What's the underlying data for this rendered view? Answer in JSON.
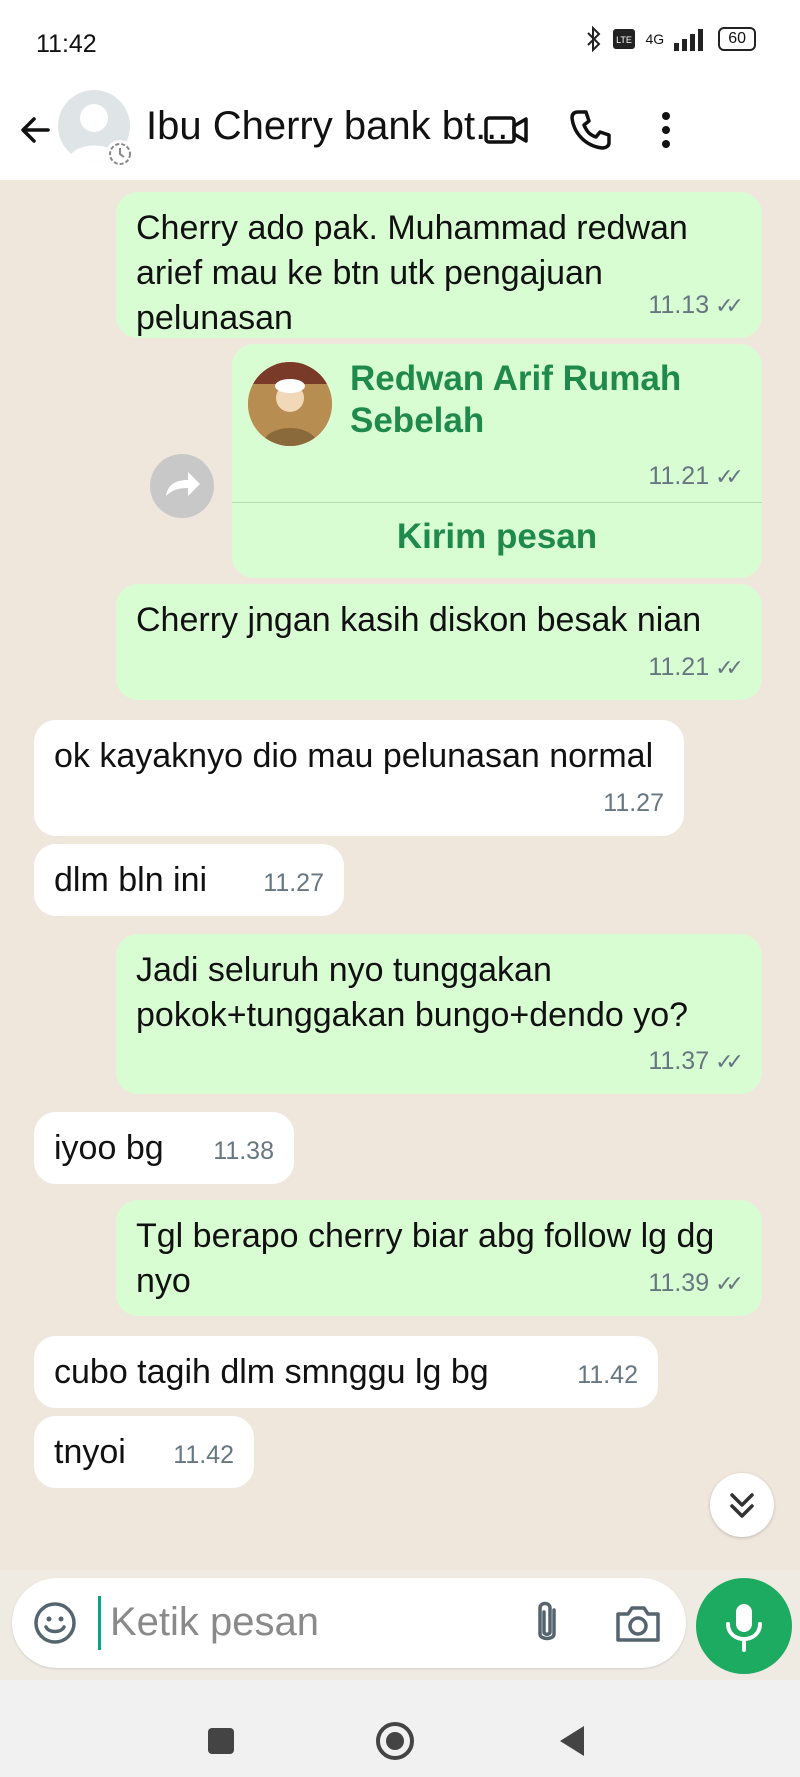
{
  "status_bar": {
    "time": "11:42",
    "network": "4G",
    "battery": "60"
  },
  "header": {
    "title": "Ibu Cherry bank bt..."
  },
  "messages": [
    {
      "text": "Cherry ado pak. Muhammad redwan arief mau ke btn utk pengajuan pelunasan",
      "time": "11.13"
    },
    {
      "contact_name": "Redwan Arif Rumah Sebelah",
      "time": "11.21",
      "action": "Kirim pesan"
    },
    {
      "text": "Cherry jngan kasih diskon besak nian",
      "time": "11.21"
    },
    {
      "text": "ok kayaknyo dio mau pelunasan normal",
      "time": "11.27"
    },
    {
      "text": "dlm bln ini",
      "time": "11.27"
    },
    {
      "text": "Jadi seluruh nyo tunggakan pokok+tunggakan bungo+dendo yo?",
      "time": "11.37"
    },
    {
      "text": "iyoo bg",
      "time": "11.38"
    },
    {
      "text": "Tgl berapo cherry biar abg follow lg dg nyo",
      "time": "11.39"
    },
    {
      "text": "cubo tagih dlm smnggu lg bg",
      "time": "11.42"
    },
    {
      "text": "tnyoi",
      "time": "11.42"
    }
  ],
  "composer": {
    "placeholder": "Ketik pesan"
  },
  "colors": {
    "outgoing_bubble": "#d9fdd3",
    "incoming_bubble": "#ffffff",
    "accent": "#1daa61",
    "contact_text": "#1f8a4c"
  },
  "icons": [
    "back-arrow-icon",
    "video-call-icon",
    "voice-call-icon",
    "more-options-icon",
    "forward-icon",
    "double-check-icon",
    "chevron-double-down-icon",
    "emoji-icon",
    "attach-icon",
    "camera-icon",
    "mic-icon",
    "nav-recents-icon",
    "nav-home-icon",
    "nav-back-icon"
  ]
}
